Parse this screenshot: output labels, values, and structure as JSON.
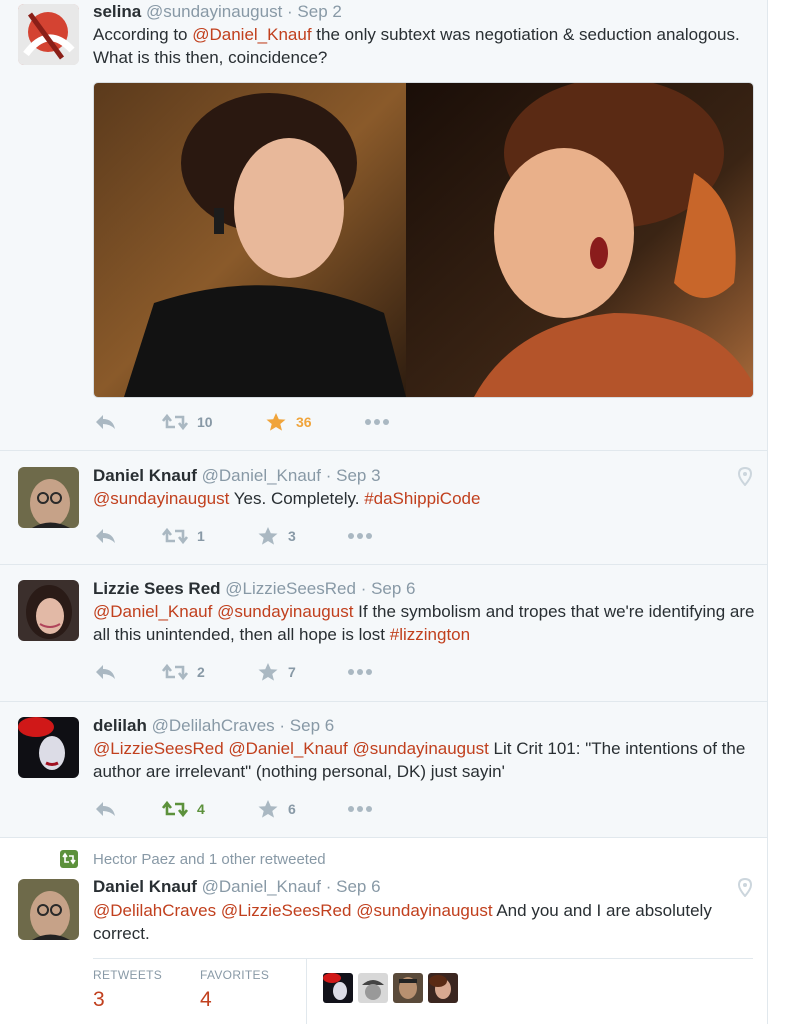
{
  "tweets": [
    {
      "name": "selina",
      "handle": "@sundayinaugust",
      "date": "· Sep 2",
      "text": [
        {
          "t": "According to ",
          "link": false
        },
        {
          "t": "@Daniel_Knauf",
          "link": true
        },
        {
          "t": " the only subtext was negotiation & seduction analogous. What is this then, coincidence?",
          "link": false
        }
      ],
      "retweets": "10",
      "favorites": "36"
    },
    {
      "name": "Daniel Knauf",
      "handle": "@Daniel_Knauf",
      "date": "· Sep 3",
      "text": [
        {
          "t": "@sundayinaugust",
          "link": true
        },
        {
          "t": " Yes. Completely. ",
          "link": false
        },
        {
          "t": "#daShippiCode",
          "link": true
        }
      ],
      "retweets": "1",
      "favorites": "3"
    },
    {
      "name": "Lizzie Sees Red",
      "handle": "@LizzieSeesRed",
      "date": "· Sep 6",
      "text": [
        {
          "t": "@Daniel_Knauf",
          "link": true
        },
        {
          "t": " ",
          "link": false
        },
        {
          "t": "@sundayinaugust",
          "link": true
        },
        {
          "t": " If the symbolism and tropes that we're identifying are all this unintended, then all hope is lost ",
          "link": false
        },
        {
          "t": "#lizzington",
          "link": true
        }
      ],
      "retweets": "2",
      "favorites": "7"
    },
    {
      "name": "delilah",
      "handle": "@DelilahCraves",
      "date": "· Sep 6",
      "text": [
        {
          "t": "@LizzieSeesRed",
          "link": true
        },
        {
          "t": " ",
          "link": false
        },
        {
          "t": "@Daniel_Knauf",
          "link": true
        },
        {
          "t": " ",
          "link": false
        },
        {
          "t": "@sundayinaugust",
          "link": true
        },
        {
          "t": " Lit Crit 101: \"The intentions of the author are irrelevant\" (nothing personal, DK) just sayin'",
          "link": false
        }
      ],
      "retweets": "4",
      "favorites": "6"
    },
    {
      "retweeted_by": "Hector Paez and 1 other retweeted",
      "name": "Daniel Knauf",
      "handle": "@Daniel_Knauf",
      "date": "· Sep 6",
      "text": [
        {
          "t": "@DelilahCraves",
          "link": true
        },
        {
          "t": " ",
          "link": false
        },
        {
          "t": "@LizzieSeesRed",
          "link": true
        },
        {
          "t": " ",
          "link": false
        },
        {
          "t": "@sundayinaugust",
          "link": true
        },
        {
          "t": " And you and I are absolutely correct.",
          "link": false
        }
      ],
      "stats": {
        "retweets_label": "RETWEETS",
        "retweets_value": "3",
        "favorites_label": "FAVORITES",
        "favorites_value": "4"
      }
    }
  ],
  "colors": {
    "link": "#c1401e",
    "favorite_active": "#f0a43b",
    "retweet_active": "#5c913b",
    "muted": "#8899a6"
  },
  "icons": [
    "reply-icon",
    "retweet-icon",
    "favorite-icon",
    "more-icon",
    "location-pin-icon"
  ]
}
